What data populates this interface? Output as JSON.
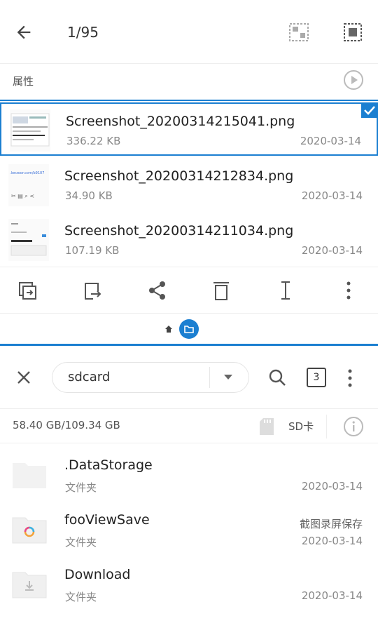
{
  "top_pane": {
    "title": "1/95",
    "properties_label": "属性",
    "files": [
      {
        "name": "Screenshot_20200314215041.png",
        "size": "336.22 KB",
        "date": "2020-03-14",
        "selected": true
      },
      {
        "name": "Screenshot_20200314212834.png",
        "size": "34.90 KB",
        "date": "2020-03-14",
        "selected": false
      },
      {
        "name": "Screenshot_20200314211034.png",
        "size": "107.19 KB",
        "date": "2020-03-14",
        "selected": false
      }
    ],
    "thumb_texts": [
      ".lonzoor.com/b9107"
    ]
  },
  "bottom_pane": {
    "path": "sdcard",
    "tab_count": "3",
    "storage": "58.40 GB/109.34 GB",
    "sd_label": "SD卡",
    "folders": [
      {
        "name": ".DataStorage",
        "sub": "文件夹",
        "date": "2020-03-14",
        "note": ""
      },
      {
        "name": "fooViewSave",
        "sub": "文件夹",
        "date": "2020-03-14",
        "note": "截图录屏保存"
      },
      {
        "name": "Download",
        "sub": "文件夹",
        "date": "2020-03-14",
        "note": ""
      }
    ]
  },
  "icons": {
    "back": "back-arrow-icon",
    "qr": "qr-scan-icon",
    "select_all": "select-all-icon",
    "play": "play-circle-icon",
    "copy_to": "copy-to-icon",
    "move_to": "move-to-icon",
    "share": "share-icon",
    "delete": "trash-icon",
    "rename": "rename-icon",
    "more": "more-vertical-icon",
    "home": "home-icon",
    "folder": "folder-icon",
    "close": "close-icon",
    "search": "search-icon",
    "sdcard": "sd-card-icon",
    "info": "info-icon"
  },
  "colors": {
    "accent": "#1b7fd1",
    "icon": "#555555"
  }
}
